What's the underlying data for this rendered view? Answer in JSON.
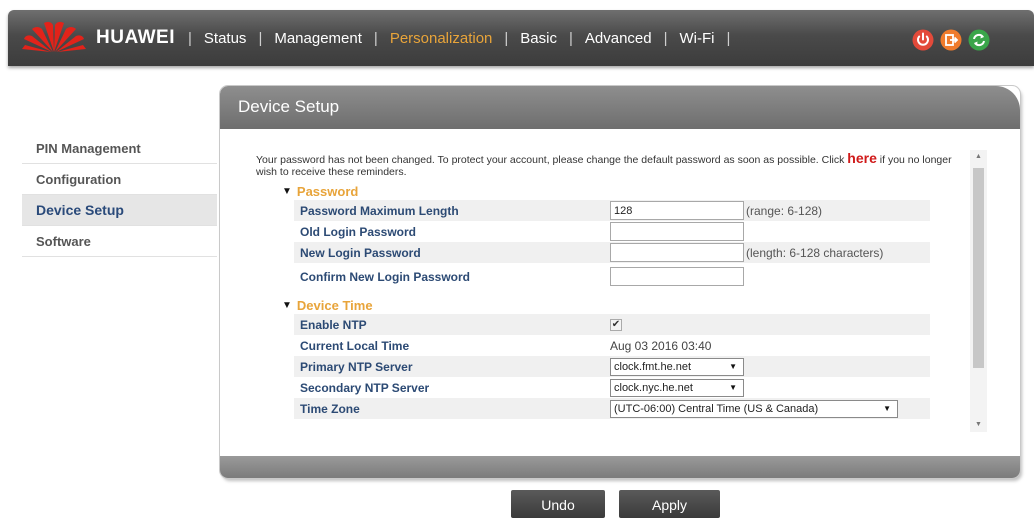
{
  "header": {
    "brand": "HUAWEI",
    "nav": [
      {
        "label": "Status"
      },
      {
        "label": "Management"
      },
      {
        "label": "Personalization"
      },
      {
        "label": "Basic"
      },
      {
        "label": "Advanced"
      },
      {
        "label": "Wi-Fi"
      }
    ],
    "icons": [
      "power-icon",
      "logout-icon",
      "refresh-icon"
    ],
    "colors": {
      "active": "#e8a43a",
      "power": "#e34a3a",
      "logout": "#f07b2c",
      "refresh": "#3aa54a"
    }
  },
  "sidebar": {
    "items": [
      {
        "label": "PIN Management"
      },
      {
        "label": "Configuration"
      },
      {
        "label": "Device Setup"
      },
      {
        "label": "Software"
      }
    ]
  },
  "panel": {
    "title": "Device Setup",
    "notice": {
      "text_before": "Your password has not been changed. To protect your account, please change the default password as soon as possible. Click ",
      "link": "here",
      "text_after": " if you no longer wish to receive these reminders."
    },
    "password": {
      "title": "Password",
      "max_length_label": "Password Maximum Length",
      "max_length_value": "128",
      "max_length_hint": "(range: 6-128)",
      "old_label": "Old Login Password",
      "new_label": "New Login Password",
      "new_hint": "(length: 6-128 characters)",
      "confirm_label": "Confirm New Login Password"
    },
    "device_time": {
      "title": "Device Time",
      "enable_ntp_label": "Enable NTP",
      "enable_ntp_mark": "✔",
      "local_time_label": "Current Local Time",
      "local_time_value": "Aug 03 2016 03:40",
      "primary_label": "Primary NTP Server",
      "primary_value": "clock.fmt.he.net",
      "secondary_label": "Secondary NTP Server",
      "secondary_value": "clock.nyc.he.net",
      "timezone_label": "Time Zone",
      "timezone_value": "(UTC-06:00) Central Time (US & Canada)"
    }
  },
  "buttons": {
    "undo": "Undo",
    "apply": "Apply"
  }
}
